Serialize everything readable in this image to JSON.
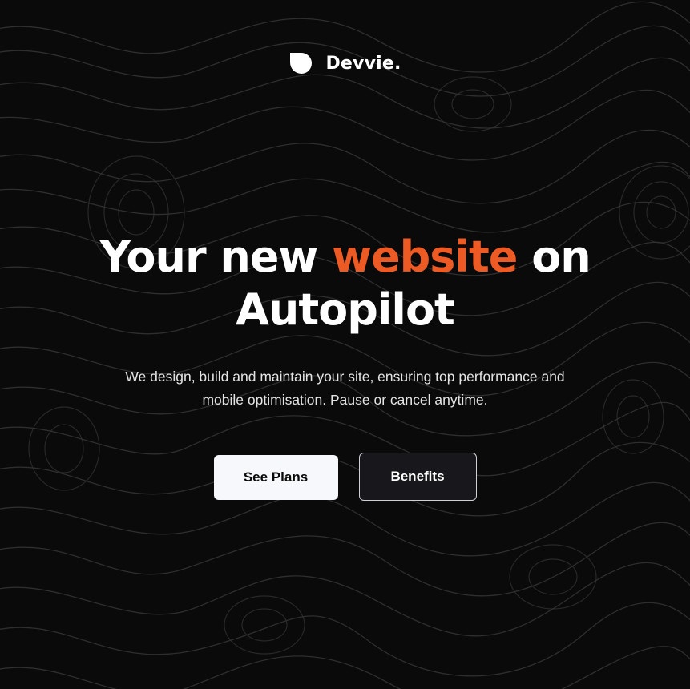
{
  "brand": {
    "name": "Devvie.",
    "logo_icon": "shield-logo-icon"
  },
  "hero": {
    "headline_part1": "Your new ",
    "headline_accent": "website",
    "headline_part2": " on",
    "headline_line2": "Autopilot",
    "subtitle_line1": "We design, build and maintain your site, ensuring top performance and",
    "subtitle_line2": "mobile optimisation. Pause or cancel anytime."
  },
  "buttons": {
    "primary_label": "See Plans",
    "secondary_label": "Benefits"
  },
  "colors": {
    "background": "#0a0a0a",
    "accent": "#ee5a24",
    "text": "#ffffff",
    "primary_button_bg": "#f7f8fb",
    "secondary_button_bg": "#18181c"
  }
}
